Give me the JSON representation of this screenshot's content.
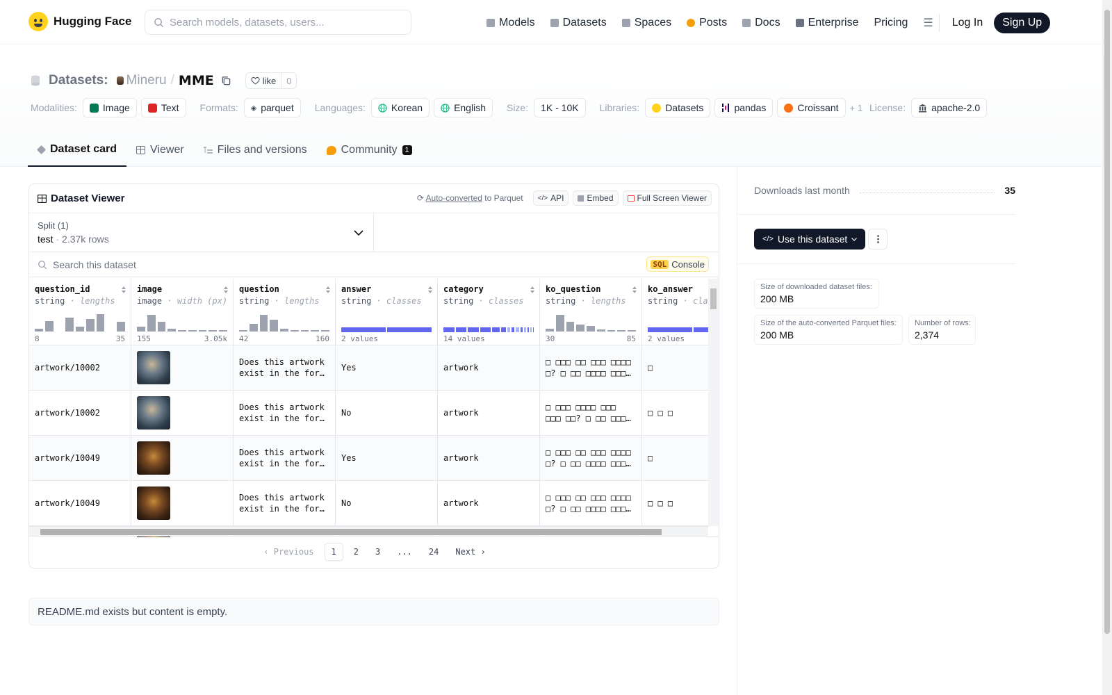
{
  "nav": {
    "logo": "Hugging Face",
    "search_placeholder": "Search models, datasets, users...",
    "links": [
      {
        "label": "Models",
        "icon": "cube-icon",
        "color": "#9ca3af"
      },
      {
        "label": "Datasets",
        "icon": "database-icon",
        "color": "#9ca3af"
      },
      {
        "label": "Spaces",
        "icon": "grid-icon",
        "color": "#9ca3af"
      },
      {
        "label": "Posts",
        "icon": "chat-bubble-icon",
        "color": "#f59e0b"
      },
      {
        "label": "Docs",
        "icon": "document-icon",
        "color": "#9ca3af"
      },
      {
        "label": "Enterprise",
        "icon": "enterprise-icon",
        "color": "#6b7280"
      },
      {
        "label": "Pricing",
        "icon": "",
        "color": ""
      }
    ],
    "login": "Log In",
    "signup": "Sign Up"
  },
  "header": {
    "section": "Datasets:",
    "org": "Mineru",
    "repo": "MME",
    "like_label": "like",
    "like_count": "0",
    "modalities_label": "Modalities:",
    "modalities": [
      {
        "label": "Image",
        "color": "#047857"
      },
      {
        "label": "Text",
        "color": "#dc2626"
      }
    ],
    "formats_label": "Formats:",
    "formats": [
      "parquet"
    ],
    "languages_label": "Languages:",
    "languages": [
      "Korean",
      "English"
    ],
    "size_label": "Size:",
    "size": "1K - 10K",
    "libraries_label": "Libraries:",
    "libraries": [
      "Datasets",
      "pandas",
      "Croissant"
    ],
    "libraries_more": "+ 1",
    "license_label": "License:",
    "license": "apache-2.0"
  },
  "tabs": [
    {
      "label": "Dataset card",
      "active": true
    },
    {
      "label": "Viewer",
      "active": false
    },
    {
      "label": "Files and versions",
      "active": false
    },
    {
      "label": "Community",
      "active": false,
      "badge": "1"
    }
  ],
  "viewer": {
    "title": "Dataset Viewer",
    "auto_converted": "Auto-converted",
    "to_parquet": " to Parquet",
    "api": "API",
    "embed": "Embed",
    "fullscreen": "Full Screen Viewer",
    "split_label": "Split (1)",
    "split_name": "test",
    "split_rows": "2.37k rows",
    "search_placeholder": "Search this dataset",
    "sql_tag": "SQL",
    "sql_console": "Console",
    "columns": [
      {
        "name": "question_id",
        "type": "string",
        "stat": "lengths",
        "min": "8",
        "max": "35",
        "hist": [
          0.15,
          0.55,
          0,
          0.7,
          0.25,
          0.65,
          0.9,
          0,
          0.5
        ]
      },
      {
        "name": "image",
        "type": "image",
        "stat": "width (px)",
        "min": "155",
        "max": "3.05k",
        "hist": [
          0.25,
          0.85,
          0.5,
          0.15,
          0.05,
          0.05,
          0.05,
          0.05,
          0.05
        ]
      },
      {
        "name": "question",
        "type": "string",
        "stat": "lengths",
        "min": "42",
        "max": "160",
        "hist": [
          0.05,
          0.4,
          0.85,
          0.6,
          0.15,
          0.05,
          0.05,
          0.05,
          0.05
        ]
      },
      {
        "name": "answer",
        "type": "string",
        "stat": "classes",
        "classes_label": "2 values",
        "classes": [
          0.5,
          0.5
        ]
      },
      {
        "name": "category",
        "type": "string",
        "stat": "classes",
        "classes_label": "14 values",
        "classes": [
          0.15,
          0.15,
          0.15,
          0.15,
          0.1,
          0.07,
          0.04,
          0.04,
          0.04,
          0.03,
          0.03,
          0.02,
          0.02,
          0.01
        ]
      },
      {
        "name": "ko_question",
        "type": "string",
        "stat": "lengths",
        "min": "30",
        "max": "85",
        "hist": [
          0.15,
          0.85,
          0.5,
          0.35,
          0.3,
          0.1,
          0.05,
          0.05,
          0.05
        ]
      },
      {
        "name": "ko_answer",
        "type": "string",
        "stat": "classes",
        "classes_label": "2 values",
        "classes": [
          0.5,
          0.5
        ]
      }
    ],
    "rows": [
      {
        "question_id": "artwork/10002",
        "thumb": "t1",
        "question": "Does this artwork exist in the form of painting?",
        "answer": "Yes",
        "category": "artwork",
        "ko_question": "□ □□□ □□ □□□ □□□□ □? □ □□ □□□□ □□□ □□□",
        "ko_answer": "□"
      },
      {
        "question_id": "artwork/10002",
        "thumb": "t1",
        "question": "Does this artwork exist in the form of sculpture?",
        "answer": "No",
        "category": "artwork",
        "ko_question": "□ □□□ □□□□ □□□ □□□ □□? □ □□ □□□□ □□□□□",
        "ko_answer": "□ □ □"
      },
      {
        "question_id": "artwork/10049",
        "thumb": "t2",
        "question": "Does this artwork exist in the form of painting?",
        "answer": "Yes",
        "category": "artwork",
        "ko_question": "□ □□□ □□ □□□ □□□□ □? □ □□ □□□□ □□□ □□□",
        "ko_answer": "□"
      },
      {
        "question_id": "artwork/10049",
        "thumb": "t2",
        "question": "Does this artwork exist in the form of sculpture?",
        "answer": "No",
        "category": "artwork",
        "ko_question": "□ □□□ □□ □□□ □□□□ □? □ □□ □□□□ □□□ □□□",
        "ko_answer": "□ □ □"
      }
    ],
    "pager": {
      "prev": "Previous",
      "pages": [
        "1",
        "2",
        "3",
        "...",
        "24"
      ],
      "current": "1",
      "next": "Next"
    }
  },
  "readme": "README.md exists but content is empty.",
  "sidebar": {
    "downloads_label": "Downloads last month",
    "downloads": "35",
    "use_button": "Use this dataset",
    "stats": [
      {
        "key": "Size of downloaded dataset files:",
        "value": "200 MB"
      },
      {
        "key": "Size of the auto-converted Parquet files:",
        "value": "200 MB"
      },
      {
        "key": "Number of rows:",
        "value": "2,374"
      }
    ]
  }
}
